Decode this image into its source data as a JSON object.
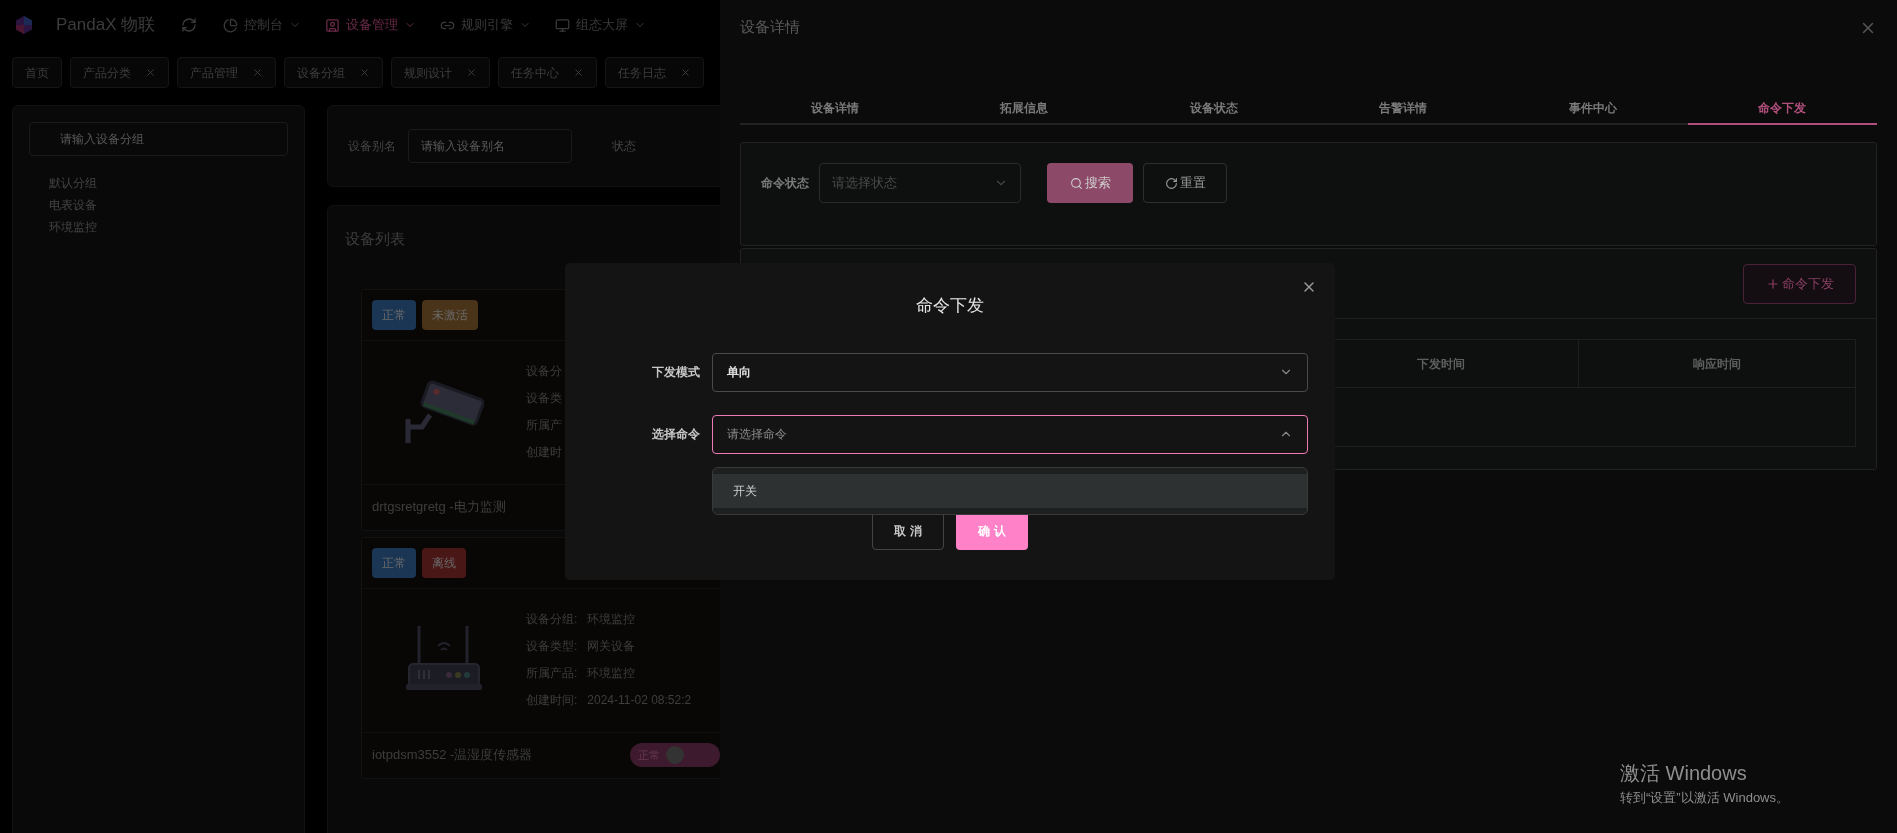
{
  "header": {
    "app_name": "PandaX 物联",
    "nav": [
      {
        "label": "控制台",
        "kind": "chart",
        "selected": false
      },
      {
        "label": "设备管理",
        "kind": "device",
        "selected": true
      },
      {
        "label": "规则引擎",
        "kind": "link",
        "selected": false
      },
      {
        "label": "组态大屏",
        "kind": "monitor",
        "selected": false
      }
    ]
  },
  "tabs": [
    {
      "label": "首页",
      "closable": false
    },
    {
      "label": "产品分类",
      "closable": true
    },
    {
      "label": "产品管理",
      "closable": true
    },
    {
      "label": "设备分组",
      "closable": true
    },
    {
      "label": "规则设计",
      "closable": true
    },
    {
      "label": "任务中心",
      "closable": true
    },
    {
      "label": "任务日志",
      "closable": true
    }
  ],
  "sidebar": {
    "search_placeholder": "请输入设备分组",
    "items": [
      "默认分组",
      "电表设备",
      "环境监控"
    ]
  },
  "filter": {
    "alias_label": "设备别名",
    "alias_placeholder": "请输入设备别名",
    "status_label": "状态"
  },
  "device_list": {
    "title": "设备列表",
    "cards": [
      {
        "kind": "camera",
        "tags": [
          {
            "label": "正常",
            "color": "#1b3554"
          },
          {
            "label": "未激活",
            "color": "#4a3419"
          }
        ],
        "info": [
          {
            "label": "设备分"
          },
          {
            "label": "设备类"
          },
          {
            "label": "所属产"
          },
          {
            "label": "创建时"
          }
        ],
        "name": "drtgsretgretg -电力监测"
      },
      {
        "kind": "router",
        "tags": [
          {
            "label": "正常",
            "color": "#1b3554"
          },
          {
            "label": "离线",
            "color": "#4a1717"
          }
        ],
        "info": [
          {
            "label": "设备分组:",
            "value": "环境监控"
          },
          {
            "label": "设备类型:",
            "value": "网关设备"
          },
          {
            "label": "所属产品:",
            "value": "环境监控"
          },
          {
            "label": "创建时间:",
            "value": "2024-11-02 08:52:2"
          }
        ],
        "name": "iotpdsm3552 -温湿度传感器",
        "toggle": {
          "label": "正常",
          "on": true
        }
      }
    ]
  },
  "drawer": {
    "title": "设备详情",
    "tabs": [
      {
        "label": "设备详情",
        "selected": false
      },
      {
        "label": "拓展信息",
        "selected": false
      },
      {
        "label": "设备状态",
        "selected": false
      },
      {
        "label": "告警详情",
        "selected": false
      },
      {
        "label": "事件中心",
        "selected": false
      },
      {
        "label": "命令下发",
        "selected": true
      }
    ],
    "search": {
      "label": "命令状态",
      "placeholder": "请选择状态",
      "search_button": "搜索",
      "reset_button": "重置"
    },
    "add_button": "命令下发",
    "table": {
      "columns": [
        "下发时间",
        "响应时间"
      ]
    }
  },
  "modal": {
    "title": "命令下发",
    "fields": [
      {
        "label": "下发模式",
        "value": "单向",
        "open": false
      },
      {
        "label": "选择命令",
        "placeholder": "请选择命令",
        "open": true
      }
    ],
    "options": [
      {
        "label": "开关",
        "highlighted": true
      }
    ],
    "buttons": [
      {
        "label": "取 消",
        "primary": false
      },
      {
        "label": "确 认",
        "primary": true
      }
    ]
  },
  "system_notice": {
    "title": "激活 Windows",
    "text": "转到“设置”以激活 Windows。"
  }
}
